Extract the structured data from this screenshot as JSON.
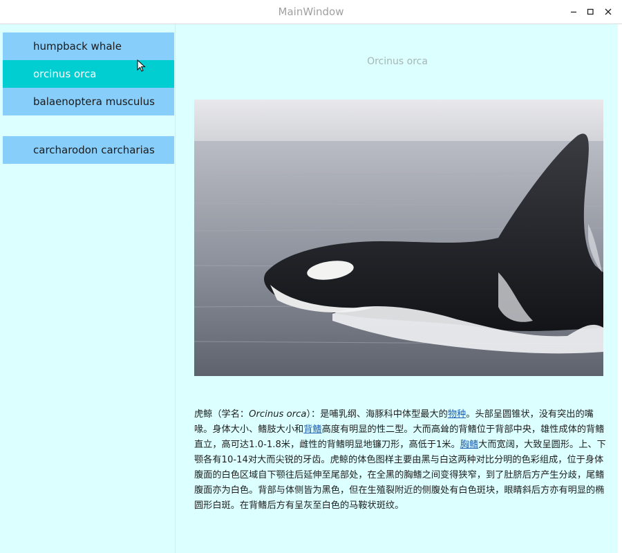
{
  "window": {
    "title": "MainWindow"
  },
  "sidebar": {
    "items": [
      {
        "label": "humpback whale"
      },
      {
        "label": "orcinus orca",
        "selected": true
      },
      {
        "label": "balaenoptera musculus"
      },
      {
        "label": "carcharodon carcharias"
      }
    ]
  },
  "main": {
    "caption": "Orcinus orca",
    "description": {
      "p1": "虎鲸（学名：",
      "p2": "Orcinus orca",
      "p3": "）：是哺乳纲、海豚科中体型最大的",
      "link1": "物种",
      "p4": "。头部呈圆锥状，没有突出的嘴喙。身体大小、鳍肢大小和",
      "link2": "背鳍",
      "p5": "高度有明显的性二型。大而高耸的背鳍位于背部中央，雄性成体的背鳍直立，高可达1.0-1.8米，雌性的背鳍明显地镰刀形，高低于1米。",
      "link3": "胸鳍",
      "p6": "大而宽阔，大致呈圆形。上、下颚各有10-14对大而尖锐的牙齿。虎鲸的体色图样主要由黑与白这两种对比分明的色彩组成，位于身体腹面的白色区域自下颚往后延伸至尾部处，在全黑的胸鳍之间变得狭窄，到了肚脐后方产生分歧，尾鳍腹面亦为白色。背部与体侧皆为黑色，但在生殖裂附近的侧腹处有白色斑块，眼睛斜后方亦有明显的椭圆形白斑。在背鳍后方有呈灰至白色的马鞍状斑纹。"
    }
  },
  "colors": {
    "item_bg": "#87cefa",
    "item_selected_bg": "#00ced1",
    "content_bg": "#dcffff",
    "link": "#1f5fb5"
  },
  "icons": [
    "minimize-icon",
    "maximize-icon",
    "close-icon",
    "mouse-cursor-icon"
  ]
}
